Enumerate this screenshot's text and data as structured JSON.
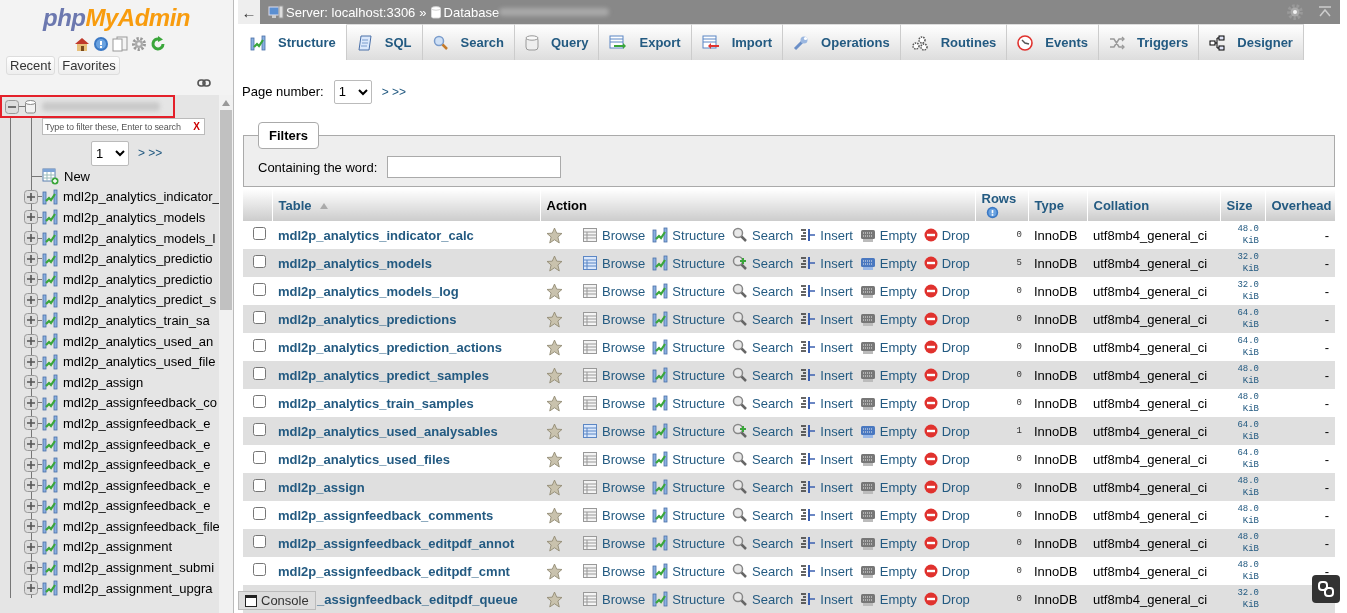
{
  "sidebar": {
    "logo_part_1": "php",
    "logo_part_2": "MyAdmin",
    "buttons": [
      "Recent",
      "Favorites"
    ],
    "database": {
      "expanded": true,
      "highlighted": true
    },
    "filter": {
      "placeholder": "Type to filter these, Enter to search",
      "clear": "X"
    },
    "page_select": "1",
    "page_next": "> >>",
    "items": [
      {
        "label": "New",
        "kind": "new"
      },
      {
        "label": "mdl2p_analytics_indicator_",
        "kind": "table",
        "expanded": false
      },
      {
        "label": "mdl2p_analytics_models",
        "kind": "table",
        "expanded": false
      },
      {
        "label": "mdl2p_analytics_models_l",
        "kind": "table",
        "expanded": false
      },
      {
        "label": "mdl2p_analytics_predictio",
        "kind": "table",
        "expanded": false
      },
      {
        "label": "mdl2p_analytics_predictio",
        "kind": "table",
        "expanded": false
      },
      {
        "label": "mdl2p_analytics_predict_s",
        "kind": "table",
        "expanded": false
      },
      {
        "label": "mdl2p_analytics_train_sa",
        "kind": "table",
        "expanded": false
      },
      {
        "label": "mdl2p_analytics_used_an",
        "kind": "table",
        "expanded": false
      },
      {
        "label": "mdl2p_analytics_used_file",
        "kind": "table",
        "expanded": false
      },
      {
        "label": "mdl2p_assign",
        "kind": "table",
        "expanded": false
      },
      {
        "label": "mdl2p_assignfeedback_co",
        "kind": "table",
        "expanded": false
      },
      {
        "label": "mdl2p_assignfeedback_e",
        "kind": "table",
        "expanded": false
      },
      {
        "label": "mdl2p_assignfeedback_e",
        "kind": "table",
        "expanded": false
      },
      {
        "label": "mdl2p_assignfeedback_e",
        "kind": "table",
        "expanded": false
      },
      {
        "label": "mdl2p_assignfeedback_e",
        "kind": "table",
        "expanded": false
      },
      {
        "label": "mdl2p_assignfeedback_e",
        "kind": "table",
        "expanded": false
      },
      {
        "label": "mdl2p_assignfeedback_file",
        "kind": "table",
        "expanded": false
      },
      {
        "label": "mdl2p_assignment",
        "kind": "table",
        "expanded": false
      },
      {
        "label": "mdl2p_assignment_submi",
        "kind": "table",
        "expanded": false
      },
      {
        "label": "mdl2p_assignment_upgra",
        "kind": "table",
        "expanded": false
      }
    ]
  },
  "topbar": {
    "back": "←",
    "server": "Server: localhost:3306",
    "separator": "»",
    "database": "Database"
  },
  "tabs": [
    {
      "label": "Structure",
      "selected": true
    },
    {
      "label": "SQL",
      "selected": false
    },
    {
      "label": "Search",
      "selected": false
    },
    {
      "label": "Query",
      "selected": false
    },
    {
      "label": "Export",
      "selected": false
    },
    {
      "label": "Import",
      "selected": false
    },
    {
      "label": "Operations",
      "selected": false
    },
    {
      "label": "Routines",
      "selected": false
    },
    {
      "label": "Events",
      "selected": false
    },
    {
      "label": "Triggers",
      "selected": false
    },
    {
      "label": "Designer",
      "selected": false
    }
  ],
  "page_number": {
    "label": "Page number:",
    "value": "1",
    "next": "> >>"
  },
  "filters": {
    "legend": "Filters",
    "label": "Containing the word:"
  },
  "table": {
    "columns": [
      "Table",
      "Action",
      "Rows",
      "Type",
      "Collation",
      "Size",
      "Overhead"
    ],
    "rows": [
      {
        "kind": "full",
        "checked": false,
        "favorite": false,
        "name": "mdl2p_analytics_indicator_calc",
        "has_data": false,
        "actions": [
          "Browse",
          "Structure",
          "Search",
          "Insert",
          "Empty",
          "Drop"
        ],
        "rows": "0",
        "type": "InnoDB",
        "collation": "utf8mb4_general_ci",
        "size": "48.0 KiB",
        "overhead": "-"
      },
      {
        "kind": "full",
        "checked": false,
        "favorite": false,
        "name": "mdl2p_analytics_models",
        "has_data": true,
        "actions": [
          "Browse",
          "Structure",
          "Search",
          "Insert",
          "Empty",
          "Drop"
        ],
        "rows": "5",
        "type": "InnoDB",
        "collation": "utf8mb4_general_ci",
        "size": "32.0 KiB",
        "overhead": "-"
      },
      {
        "kind": "full",
        "checked": false,
        "favorite": false,
        "name": "mdl2p_analytics_models_log",
        "has_data": false,
        "actions": [
          "Browse",
          "Structure",
          "Search",
          "Insert",
          "Empty",
          "Drop"
        ],
        "rows": "0",
        "type": "InnoDB",
        "collation": "utf8mb4_general_ci",
        "size": "32.0 KiB",
        "overhead": "-"
      },
      {
        "kind": "full",
        "checked": false,
        "favorite": false,
        "name": "mdl2p_analytics_predictions",
        "has_data": false,
        "actions": [
          "Browse",
          "Structure",
          "Search",
          "Insert",
          "Empty",
          "Drop"
        ],
        "rows": "0",
        "type": "InnoDB",
        "collation": "utf8mb4_general_ci",
        "size": "64.0 KiB",
        "overhead": "-"
      },
      {
        "kind": "full",
        "checked": false,
        "favorite": false,
        "name": "mdl2p_analytics_prediction_actions",
        "has_data": false,
        "actions": [
          "Browse",
          "Structure",
          "Search",
          "Insert",
          "Empty",
          "Drop"
        ],
        "rows": "0",
        "type": "InnoDB",
        "collation": "utf8mb4_general_ci",
        "size": "64.0 KiB",
        "overhead": "-"
      },
      {
        "kind": "full",
        "checked": false,
        "favorite": false,
        "name": "mdl2p_analytics_predict_samples",
        "has_data": false,
        "actions": [
          "Browse",
          "Structure",
          "Search",
          "Insert",
          "Empty",
          "Drop"
        ],
        "rows": "0",
        "type": "InnoDB",
        "collation": "utf8mb4_general_ci",
        "size": "48.0 KiB",
        "overhead": "-"
      },
      {
        "kind": "full",
        "checked": false,
        "favorite": false,
        "name": "mdl2p_analytics_train_samples",
        "has_data": false,
        "actions": [
          "Browse",
          "Structure",
          "Search",
          "Insert",
          "Empty",
          "Drop"
        ],
        "rows": "0",
        "type": "InnoDB",
        "collation": "utf8mb4_general_ci",
        "size": "48.0 KiB",
        "overhead": "-"
      },
      {
        "kind": "full",
        "checked": false,
        "favorite": false,
        "name": "mdl2p_analytics_used_analysables",
        "has_data": true,
        "actions": [
          "Browse",
          "Structure",
          "Search",
          "Insert",
          "Empty",
          "Drop"
        ],
        "rows": "1",
        "type": "InnoDB",
        "collation": "utf8mb4_general_ci",
        "size": "64.0 KiB",
        "overhead": "-"
      },
      {
        "kind": "full",
        "checked": false,
        "favorite": false,
        "name": "mdl2p_analytics_used_files",
        "has_data": false,
        "actions": [
          "Browse",
          "Structure",
          "Search",
          "Insert",
          "Empty",
          "Drop"
        ],
        "rows": "0",
        "type": "InnoDB",
        "collation": "utf8mb4_general_ci",
        "size": "64.0 KiB",
        "overhead": "-"
      },
      {
        "kind": "full",
        "checked": false,
        "favorite": false,
        "name": "mdl2p_assign",
        "has_data": false,
        "actions": [
          "Browse",
          "Structure",
          "Search",
          "Insert",
          "Empty",
          "Drop"
        ],
        "rows": "0",
        "type": "InnoDB",
        "collation": "utf8mb4_general_ci",
        "size": "48.0 KiB",
        "overhead": "-"
      },
      {
        "kind": "full",
        "checked": false,
        "favorite": false,
        "name": "mdl2p_assignfeedback_comments",
        "has_data": false,
        "actions": [
          "Browse",
          "Structure",
          "Search",
          "Insert",
          "Empty",
          "Drop"
        ],
        "rows": "0",
        "type": "InnoDB",
        "collation": "utf8mb4_general_ci",
        "size": "48.0 KiB",
        "overhead": "-"
      },
      {
        "kind": "full",
        "checked": false,
        "favorite": false,
        "name": "mdl2p_assignfeedback_editpdf_annot",
        "has_data": false,
        "actions": [
          "Browse",
          "Structure",
          "Search",
          "Insert",
          "Empty",
          "Drop"
        ],
        "rows": "0",
        "type": "InnoDB",
        "collation": "utf8mb4_general_ci",
        "size": "48.0 KiB",
        "overhead": "-"
      },
      {
        "kind": "full",
        "checked": false,
        "favorite": false,
        "name": "mdl2p_assignfeedback_editpdf_cmnt",
        "has_data": false,
        "actions": [
          "Browse",
          "Structure",
          "Search",
          "Insert",
          "Empty",
          "Drop"
        ],
        "rows": "0",
        "type": "InnoDB",
        "collation": "utf8mb4_general_ci",
        "size": "48.0 KiB",
        "overhead": "-"
      },
      {
        "kind": "covered",
        "favorite": false,
        "name": "_assignfeedback_editpdf_queue",
        "has_data": false,
        "actions": [
          "Browse",
          "Structure",
          "Search",
          "Insert",
          "Empty",
          "Drop"
        ],
        "rows": "0",
        "type": "InnoDB",
        "collation": "utf8mb4_general_ci",
        "size": "32.0 KiB"
      }
    ]
  },
  "console": "Console"
}
